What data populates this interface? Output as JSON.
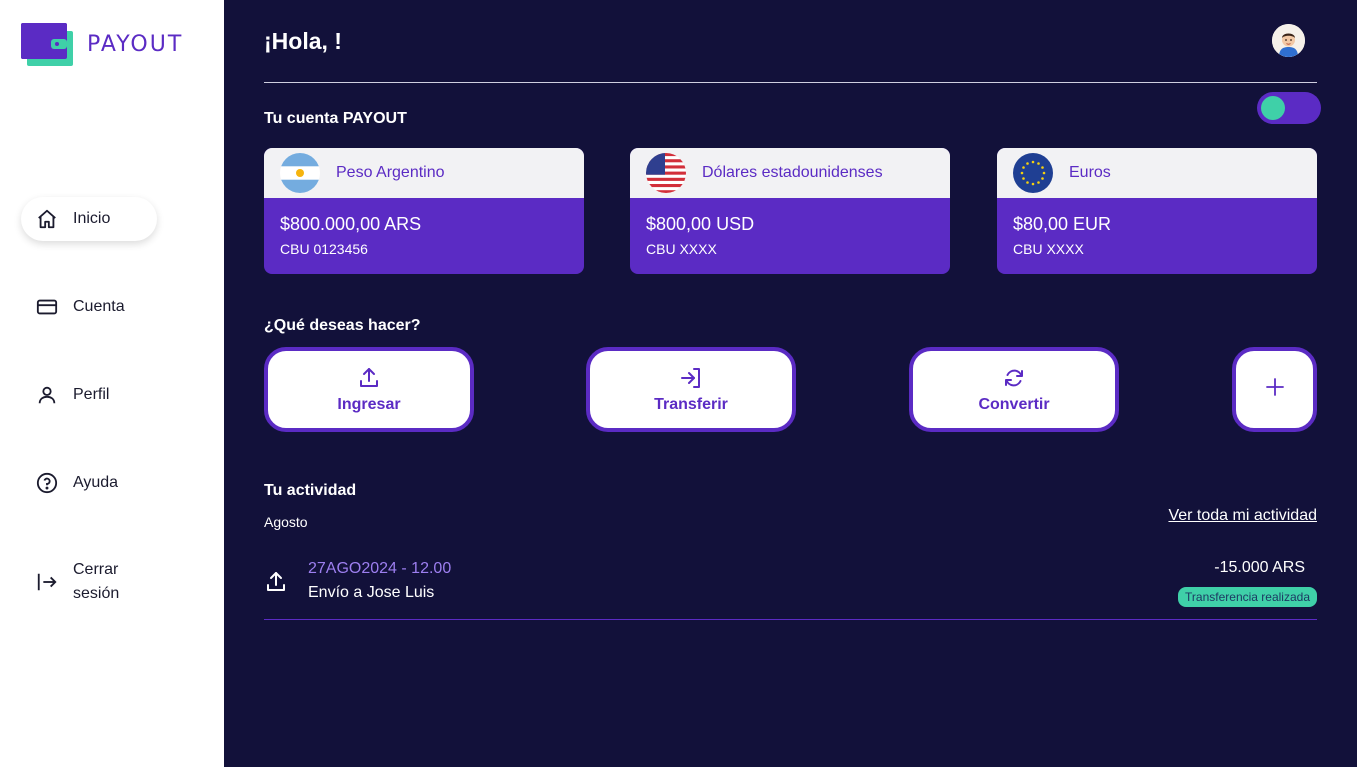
{
  "brand": {
    "name": "PAYOUT",
    "accent": "#5b2bc4",
    "accent_light": "#9d7ff0",
    "success": "#3fd0a8",
    "bg": "#12113a"
  },
  "sidebar": {
    "items": [
      {
        "label": "Inicio",
        "icon": "home-icon",
        "active": true
      },
      {
        "label": "Cuenta",
        "icon": "card-icon"
      },
      {
        "label": "Perfil",
        "icon": "user-icon"
      },
      {
        "label": "Ayuda",
        "icon": "help-icon"
      },
      {
        "label": "Cerrar sesión",
        "icon": "logout-icon"
      }
    ]
  },
  "header": {
    "greeting": "¡Hola, !"
  },
  "accounts": {
    "title": "Tu cuenta PAYOUT",
    "toggle_on": true,
    "items": [
      {
        "name": "Peso Argentino",
        "amount": "$800.000,00 ARS",
        "cbu": "CBU 0123456",
        "flag": "argentina-flag-icon"
      },
      {
        "name": "Dólares estadounidenses",
        "amount": "$800,00 USD",
        "cbu": "CBU XXXX",
        "flag": "usa-flag-icon"
      },
      {
        "name": "Euros",
        "amount": "$80,00 EUR",
        "cbu": "CBU XXXX",
        "flag": "eu-flag-icon"
      }
    ]
  },
  "actions": {
    "title": "¿Qué deseas hacer?",
    "items": [
      {
        "label": "Ingresar",
        "icon": "upload-icon"
      },
      {
        "label": "Transferir",
        "icon": "transfer-icon"
      },
      {
        "label": "Convertir",
        "icon": "refresh-icon"
      },
      {
        "label": "",
        "icon": "plus-icon"
      }
    ]
  },
  "activity": {
    "title": "Tu actividad",
    "month": "Agosto",
    "see_all": "Ver toda mi actividad",
    "transactions": [
      {
        "date": "27AGO2024 - 12.00",
        "description": "Envío a Jose Luis",
        "amount": "-15.000 ARS",
        "status": "Transferencia realizada",
        "icon": "upload-icon"
      }
    ]
  }
}
